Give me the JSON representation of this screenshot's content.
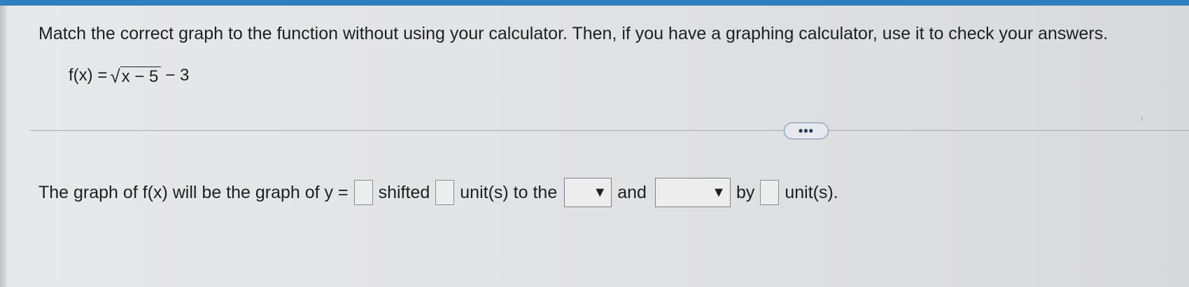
{
  "question": {
    "text": "Match the correct graph to the function without using your calculator. Then, if you have a graphing calculator, use it to check your answers."
  },
  "formula": {
    "lhs": "f(x) =",
    "radicand": "x − 5",
    "rhs": "− 3"
  },
  "more_button": {
    "label": "•••"
  },
  "answer": {
    "part1": "The graph of f(x) will be the graph of y =",
    "part2": "shifted",
    "part3": "unit(s) to the",
    "part4": "and",
    "part5": "by",
    "part6": "unit(s).",
    "blank1_value": "",
    "blank2_value": "",
    "blank3_value": "",
    "dropdown1_value": "",
    "dropdown2_value": "",
    "dropdown_arrow": "▼"
  },
  "colors": {
    "top_bar": "#2f7fbd",
    "more_button_border": "#6d8fb3"
  }
}
